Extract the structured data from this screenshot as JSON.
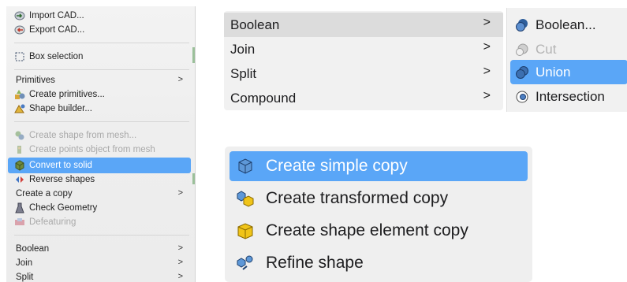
{
  "left_menu": {
    "items": [
      {
        "label": "Import CAD...",
        "icon": "import-cad-icon",
        "state": "normal"
      },
      {
        "label": "Export CAD...",
        "icon": "export-cad-icon",
        "state": "normal"
      },
      {
        "label": "Box selection",
        "icon": "box-selection-icon",
        "state": "normal"
      },
      {
        "label": "Primitives",
        "icon": "",
        "state": "normal",
        "submenu": true
      },
      {
        "label": "Create primitives...",
        "icon": "create-primitives-icon",
        "state": "normal"
      },
      {
        "label": "Shape builder...",
        "icon": "shape-builder-icon",
        "state": "normal"
      },
      {
        "label": "Create shape from mesh...",
        "icon": "shape-from-mesh-icon",
        "state": "disabled"
      },
      {
        "label": "Create points object from mesh",
        "icon": "points-from-mesh-icon",
        "state": "disabled"
      },
      {
        "label": "Convert to solid",
        "icon": "convert-to-solid-icon",
        "state": "selected"
      },
      {
        "label": "Reverse shapes",
        "icon": "reverse-shapes-icon",
        "state": "normal"
      },
      {
        "label": "Create a copy",
        "icon": "",
        "state": "normal",
        "submenu": true
      },
      {
        "label": "Check Geometry",
        "icon": "check-geometry-icon",
        "state": "normal"
      },
      {
        "label": "Defeaturing",
        "icon": "defeaturing-icon",
        "state": "disabled"
      },
      {
        "label": "Boolean",
        "icon": "",
        "state": "normal",
        "submenu": true
      },
      {
        "label": "Join",
        "icon": "",
        "state": "normal",
        "submenu": true
      },
      {
        "label": "Split",
        "icon": "",
        "state": "normal",
        "submenu": true
      }
    ],
    "arrow": ">"
  },
  "mid_menu": {
    "items": [
      {
        "label": "Boolean",
        "state": "hover"
      },
      {
        "label": "Join",
        "state": "normal"
      },
      {
        "label": "Split",
        "state": "normal"
      },
      {
        "label": "Compound",
        "state": "normal"
      }
    ],
    "arrow": ">"
  },
  "boolean_submenu": {
    "items": [
      {
        "label": "Boolean...",
        "icon": "boolean-icon",
        "state": "normal"
      },
      {
        "label": "Cut",
        "icon": "cut-icon",
        "state": "disabled"
      },
      {
        "label": "Union",
        "icon": "union-icon",
        "state": "selected"
      },
      {
        "label": "Intersection",
        "icon": "intersection-icon",
        "state": "normal"
      }
    ]
  },
  "copy_menu": {
    "items": [
      {
        "label": "Create simple copy",
        "icon": "simple-copy-icon",
        "state": "selected"
      },
      {
        "label": "Create transformed copy",
        "icon": "transformed-copy-icon",
        "state": "normal"
      },
      {
        "label": "Create shape element copy",
        "icon": "element-copy-icon",
        "state": "normal"
      },
      {
        "label": "Refine shape",
        "icon": "refine-shape-icon",
        "state": "normal"
      }
    ]
  },
  "colors": {
    "selection": "#5aa6f7",
    "menu_bg": "#f1f1f1",
    "disabled_text": "#a9a9a9"
  }
}
